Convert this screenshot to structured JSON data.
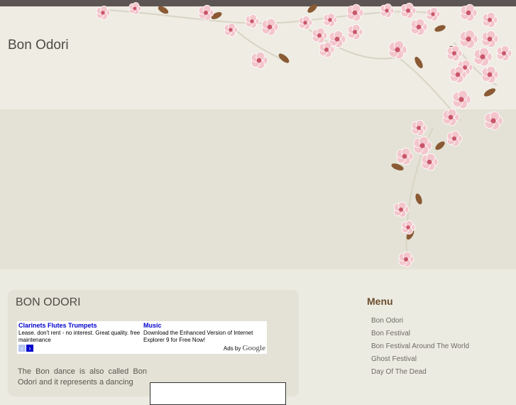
{
  "site": {
    "title": "Bon Odori"
  },
  "content": {
    "title": "BON ODORI",
    "body_text": "The Bon dance is also called Bon Odori and it represents a dancing"
  },
  "ads": {
    "items": [
      {
        "title": "Clarinets Flutes Trumpets",
        "text": "Lease. don't rent - no interest. Great quality. free maintenance"
      },
      {
        "title": "Music",
        "text": "Download the Enhanced Version of Internet Explorer 9 for Free Now!"
      }
    ],
    "prev_glyph": "‹",
    "next_glyph": "›",
    "ads_by": "Ads by",
    "brand": "Google"
  },
  "sidebar": {
    "menu_title": "Menu",
    "items": [
      "Bon Odori",
      "Bon Festival",
      "Bon Festival Around The World",
      "Ghost Festival",
      "Day Of The Dead"
    ]
  },
  "colors": {
    "blossom": "#f3c6cc",
    "blossom_center": "#c9566a",
    "leaf": "#8a5a34",
    "branch": "#d8d4c4"
  }
}
